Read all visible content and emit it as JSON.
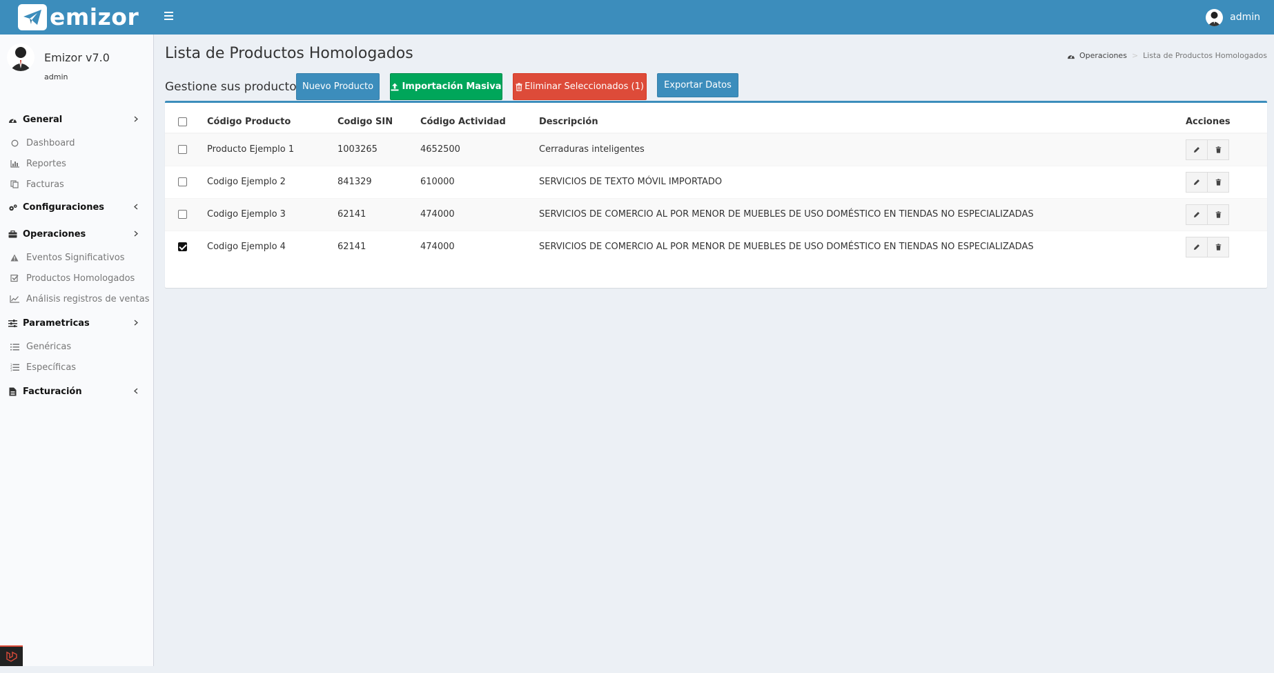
{
  "brand": {
    "logo_text": "emizor"
  },
  "header": {
    "user_name": "admin"
  },
  "sidebar": {
    "app_name": "Emizor v7.0",
    "user_role": "admin",
    "sections": [
      {
        "label": "General",
        "icon": "dashboard-icon",
        "items": [
          {
            "label": "Dashboard",
            "icon": "circle-icon"
          },
          {
            "label": "Reportes",
            "icon": "bar-chart-icon"
          },
          {
            "label": "Facturas",
            "icon": "copy-icon"
          }
        ]
      },
      {
        "label": "Configuraciones",
        "icon": "cogs-icon",
        "items": []
      },
      {
        "label": "Operaciones",
        "icon": "briefcase-icon",
        "items": [
          {
            "label": "Eventos Significativos",
            "icon": "warning-icon"
          },
          {
            "label": "Productos Homologados",
            "icon": "check-square-icon"
          },
          {
            "label": "Análisis registros de ventas",
            "icon": "line-chart-icon"
          }
        ]
      },
      {
        "label": "Parametricas",
        "icon": "sliders-icon",
        "items": [
          {
            "label": "Genéricas",
            "icon": "list-icon"
          },
          {
            "label": "Específicas",
            "icon": "list-ol-icon"
          }
        ]
      },
      {
        "label": "Facturación",
        "icon": "file-icon",
        "items": []
      }
    ]
  },
  "page": {
    "title": "Lista de Productos Homologados",
    "subtitle": "Gestione sus productos",
    "breadcrumb": {
      "home": "Operaciones",
      "current": "Lista de Productos Homologados"
    }
  },
  "toolbar": {
    "new_label": "Nuevo Producto",
    "import_label": "Importación Masiva",
    "delete_label": "Eliminar Seleccionados (1)",
    "export_label": "Exportar Datos"
  },
  "table": {
    "columns": [
      "Código Producto",
      "Codigo SIN",
      "Código Actividad",
      "Descripción",
      "Acciones"
    ],
    "rows": [
      {
        "checked": false,
        "codigo": "Producto Ejemplo 1",
        "sin": "1003265",
        "actividad": "4652500",
        "descripcion": "Cerraduras inteligentes"
      },
      {
        "checked": false,
        "codigo": "Codigo Ejemplo 2",
        "sin": "841329",
        "actividad": "610000",
        "descripcion": "SERVICIOS DE TEXTO MÓVIL IMPORTADO"
      },
      {
        "checked": false,
        "codigo": "Codigo Ejemplo 3",
        "sin": "62141",
        "actividad": "474000",
        "descripcion": "SERVICIOS DE COMERCIO AL POR MENOR DE MUEBLES DE USO DOMÉSTICO EN TIENDAS NO ESPECIALIZADAS"
      },
      {
        "checked": true,
        "codigo": "Codigo Ejemplo 4",
        "sin": "62141",
        "actividad": "474000",
        "descripcion": "SERVICIOS DE COMERCIO AL POR MENOR DE MUEBLES DE USO DOMÉSTICO EN TIENDAS NO ESPECIALIZADAS"
      }
    ]
  },
  "colors": {
    "primary": "#3c8dbc",
    "success": "#00a65a",
    "danger": "#dd4b39",
    "background": "#ecf0f5"
  }
}
